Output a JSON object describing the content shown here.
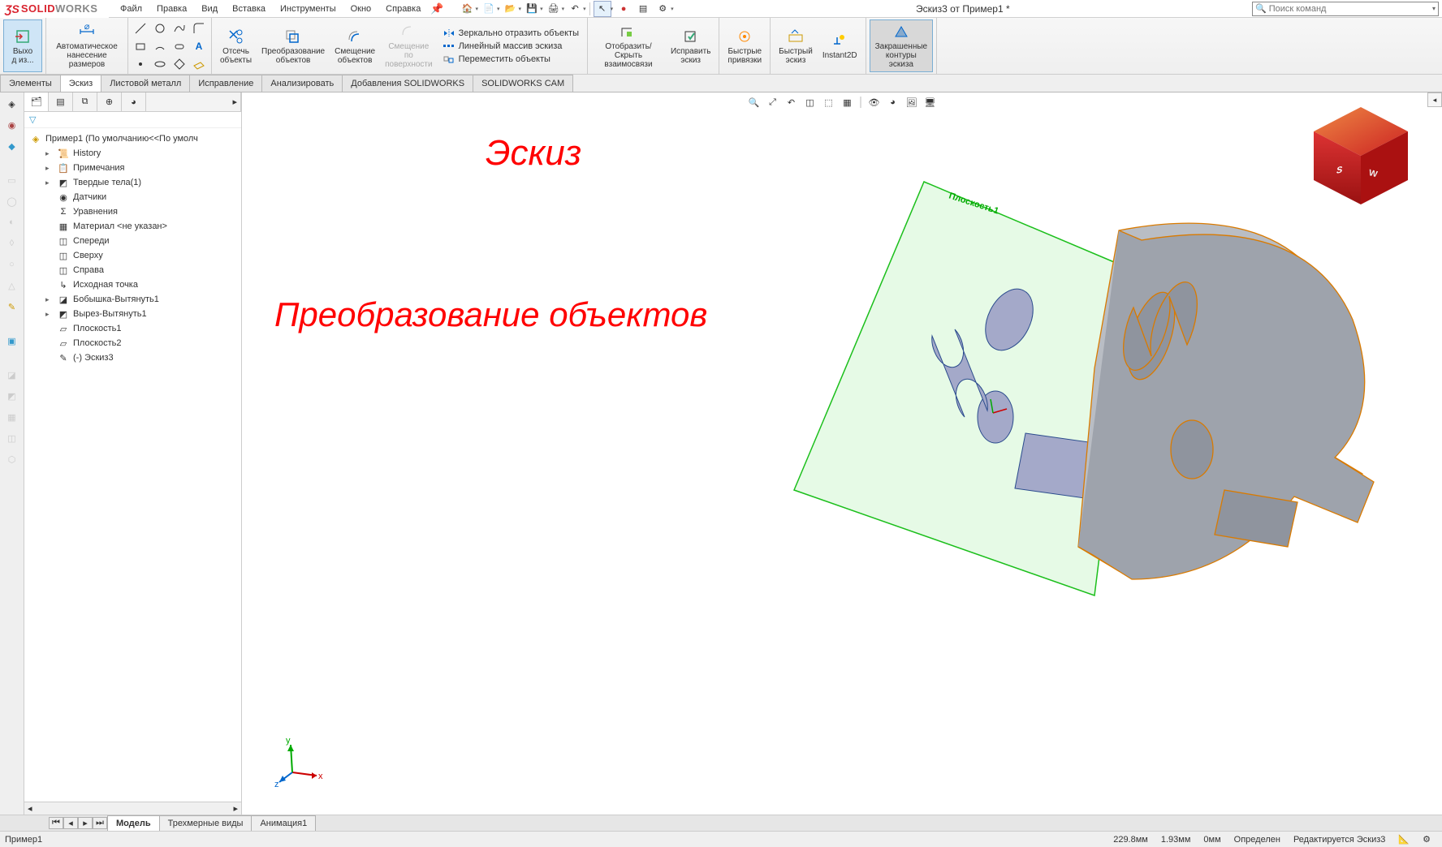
{
  "app": {
    "brand_ds": "ÔS",
    "brand_solid": "SOLID",
    "brand_works": "WORKS"
  },
  "menu": {
    "items": [
      "Файл",
      "Правка",
      "Вид",
      "Вставка",
      "Инструменты",
      "Окно",
      "Справка"
    ]
  },
  "doc_title": "Эскиз3 от Пример1 *",
  "search": {
    "placeholder": "Поиск команд"
  },
  "ribbon": {
    "exit": "Выхо\nд из...",
    "smartdim": "Автоматическое\nнанесение размеров",
    "trim": "Отсечь\nобъекты",
    "convert": "Преобразование\nобъектов",
    "offset": "Смещение\nобъектов",
    "offset_surface": "Смещение\nпо\nповерхности",
    "mirror": "Зеркально отразить объекты",
    "linear": "Линейный массив эскиза",
    "move": "Переместить объекты",
    "display_rel": "Отобразить/Скрыть\nвзаимосвязи",
    "repair": "Исправить\nэскиз",
    "quicksnap": "Быстрые\nпривязки",
    "rapid": "Быстрый\nэскиз",
    "instant": "Instant2D",
    "shaded": "Закрашенные\nконтуры\nэскиза"
  },
  "tabs": [
    "Элементы",
    "Эскиз",
    "Листовой металл",
    "Исправление",
    "Анализировать",
    "Добавления SOLIDWORKS",
    "SOLIDWORKS CAM"
  ],
  "active_tab": "Эскиз",
  "tree": {
    "root": "Пример1  (По умолчанию<<По умолч",
    "items": [
      {
        "label": "History",
        "ico": "📜",
        "exp": "▸"
      },
      {
        "label": "Примечания",
        "ico": "📋",
        "exp": "▸"
      },
      {
        "label": "Твердые тела(1)",
        "ico": "◩",
        "exp": "▸"
      },
      {
        "label": "Датчики",
        "ico": "◉",
        "exp": ""
      },
      {
        "label": "Уравнения",
        "ico": "Σ",
        "exp": ""
      },
      {
        "label": "Материал <не указан>",
        "ico": "▦",
        "exp": ""
      },
      {
        "label": "Спереди",
        "ico": "◫",
        "exp": ""
      },
      {
        "label": "Сверху",
        "ico": "◫",
        "exp": ""
      },
      {
        "label": "Справа",
        "ico": "◫",
        "exp": ""
      },
      {
        "label": "Исходная точка",
        "ico": "↳",
        "exp": ""
      },
      {
        "label": "Бобышка-Вытянуть1",
        "ico": "◪",
        "exp": "▸"
      },
      {
        "label": "Вырез-Вытянуть1",
        "ico": "◩",
        "exp": "▸"
      },
      {
        "label": "Плоскость1",
        "ico": "▱",
        "exp": ""
      },
      {
        "label": "Плоскость2",
        "ico": "▱",
        "exp": ""
      },
      {
        "label": "(-) Эскиз3",
        "ico": "✎",
        "exp": ""
      }
    ]
  },
  "overlay": {
    "title": "Эскиз",
    "sub": "Преобразование объектов"
  },
  "plane_label": "Плоскость1",
  "bottom_tabs": [
    "Модель",
    "Трехмерные виды",
    "Анимация1"
  ],
  "active_bottom": "Модель",
  "status": {
    "left": "Пример1",
    "dim1": "229.8мм",
    "dim2": "1.93мм",
    "dim3": "0мм",
    "defined": "Определен",
    "editing": "Редактируется Эскиз3"
  },
  "triad": {
    "x": "x",
    "y": "y",
    "z": "z"
  }
}
